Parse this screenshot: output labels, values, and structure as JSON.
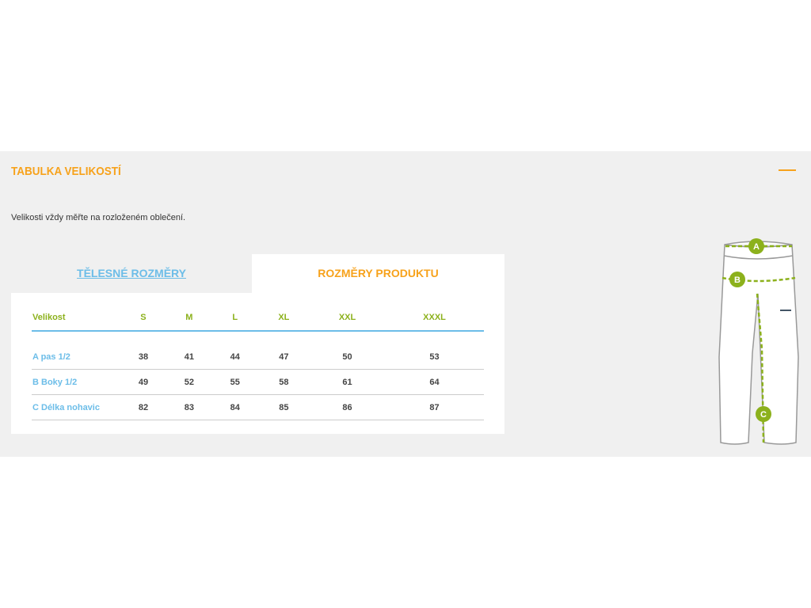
{
  "section": {
    "title": "TABULKA VELIKOSTÍ",
    "note": "Velikosti vždy měřte na rozloženém oblečení."
  },
  "tabs": [
    {
      "label": "TĚLESNÉ ROZMĚRY"
    },
    {
      "label": "ROZMĚRY PRODUKTU"
    }
  ],
  "table": {
    "headers": [
      "Velikost",
      "S",
      "M",
      "L",
      "XL",
      "XXL",
      "XXXL"
    ],
    "rows": [
      {
        "label": "A pas 1/2",
        "values": [
          "38",
          "41",
          "44",
          "47",
          "50",
          "53"
        ]
      },
      {
        "label": "B Boky 1/2",
        "values": [
          "49",
          "52",
          "55",
          "58",
          "61",
          "64"
        ]
      },
      {
        "label": "C Délka nohavic",
        "values": [
          "82",
          "83",
          "84",
          "85",
          "86",
          "87"
        ]
      }
    ]
  },
  "diagram": {
    "markers": [
      "A",
      "B",
      "C"
    ]
  },
  "colors": {
    "accent": "#f7a21b",
    "link": "#6cbde8",
    "green": "#8cb11c",
    "panel": "#f0f0f0"
  }
}
